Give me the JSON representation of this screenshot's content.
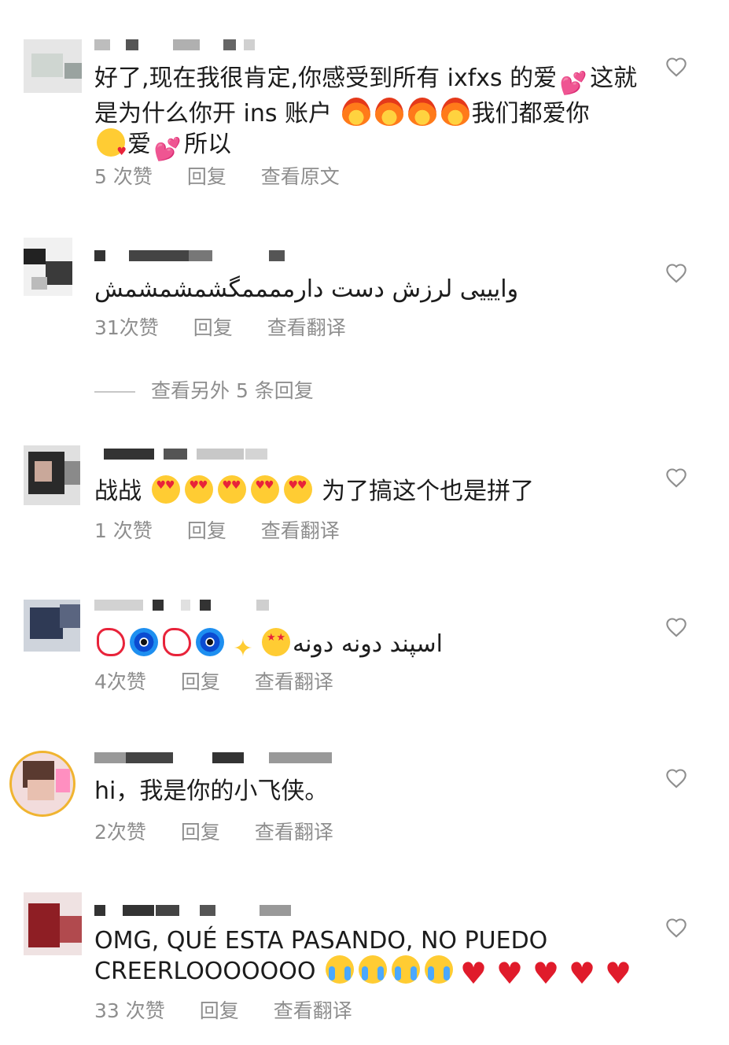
{
  "comments": [
    {
      "text_parts": [
        "好了,现在我很肯定,你感受到所有 ixfxs 的爱",
        "这就是为什么你开 ins 账户",
        "我们都爱你",
        "爱",
        "所以"
      ],
      "likes": "5 次赞",
      "reply": "回复",
      "translate": "查看原文"
    },
    {
      "text": "وایییی لرزش دست دارممممگشمشمشمش",
      "likes": "31次赞",
      "reply": "回复",
      "translate": "查看翻译"
    },
    {
      "text_parts": [
        "战战",
        "为了搞这个也是拼了"
      ],
      "likes": "1 次赞",
      "reply": "回复",
      "translate": "查看翻译"
    },
    {
      "text": "اسپند دونه دونه",
      "likes": "4次赞",
      "reply": "回复",
      "translate": "查看翻译"
    },
    {
      "text": "hi，我是你的小飞侠。",
      "likes": "2次赞",
      "reply": "回复",
      "translate": "查看翻译"
    },
    {
      "text_parts": [
        "OMG, QUÉ ESTA PASANDO, NO PUEDO",
        "CREERLOOOOOOO"
      ],
      "likes": "33 次赞",
      "reply": "回复",
      "translate": "查看翻译"
    }
  ],
  "more_replies": "查看另外 5 条回复",
  "icons": {
    "like": "heart-outline-icon",
    "emoji": [
      "two-hearts-emoji",
      "fire-emoji",
      "kissing-heart-emoji",
      "heart-eyes-emoji",
      "anger-emoji",
      "evil-eye-emoji",
      "sparkles-emoji",
      "star-struck-emoji",
      "crying-emoji",
      "red-heart-emoji"
    ]
  },
  "colors": {
    "text": "#1c1c1c",
    "meta": "#8e8e8e",
    "heart_red": "#e01b2b"
  }
}
